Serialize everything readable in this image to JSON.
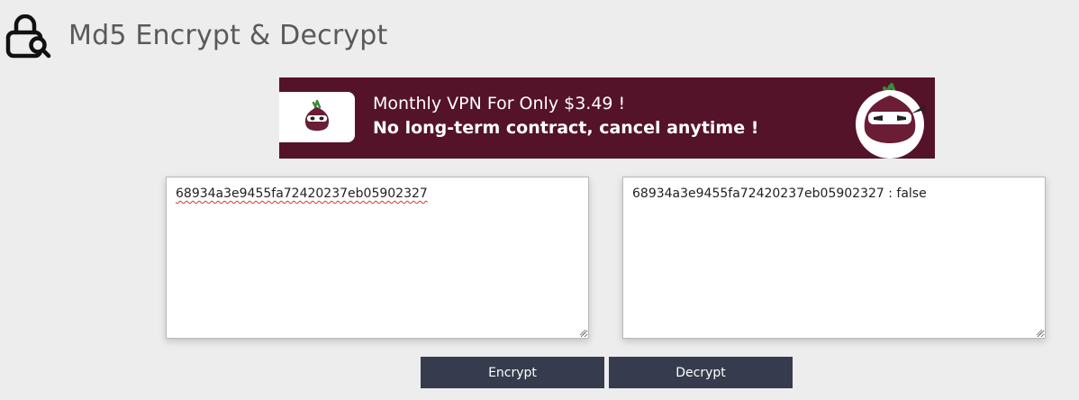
{
  "header": {
    "title": "Md5 Encrypt & Decrypt",
    "logo_icon": "lock-search-icon"
  },
  "ad": {
    "line1": "Monthly VPN For Only $3.49 !",
    "line2": "No long-term contract, cancel anytime !",
    "background_color": "#541329",
    "icon": "onion-mascot-icon"
  },
  "input_box": {
    "value": "68934a3e9455fa72420237eb05902327"
  },
  "output_box": {
    "value": "68934a3e9455fa72420237eb05902327 : false"
  },
  "buttons": {
    "encrypt_label": "Encrypt",
    "decrypt_label": "Decrypt",
    "color": "#363c4e"
  }
}
